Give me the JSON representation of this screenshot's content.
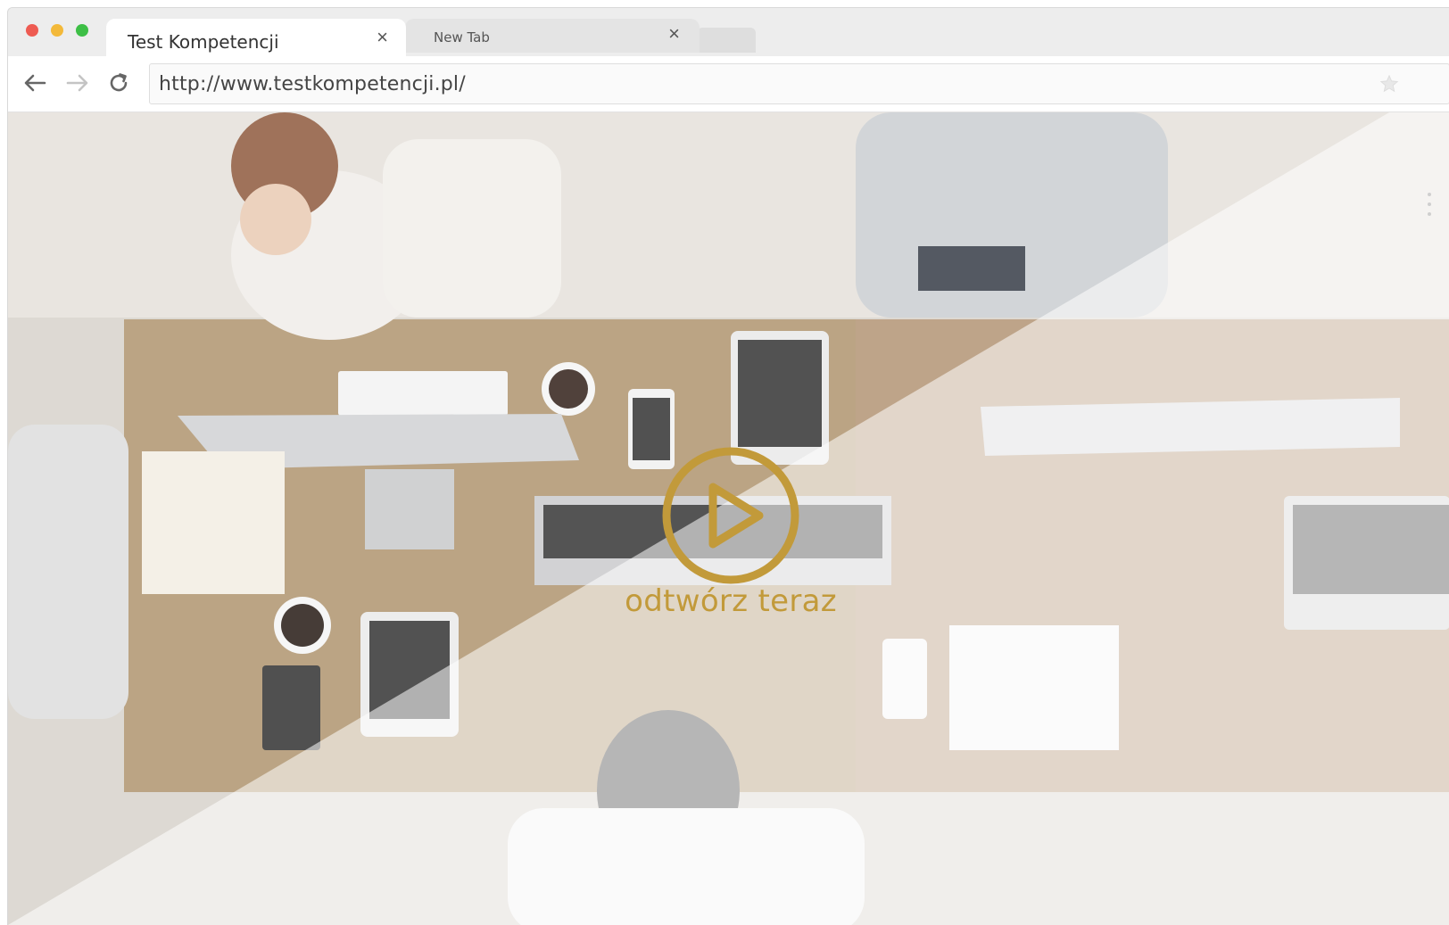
{
  "window": {
    "controls": [
      "close",
      "minimize",
      "maximize"
    ]
  },
  "tabs": [
    {
      "label": "Test Kompetencji",
      "active": true,
      "close": "×"
    },
    {
      "label": "New Tab",
      "active": false,
      "close": "×"
    }
  ],
  "toolbar": {
    "back_icon": "arrow-left-icon",
    "forward_icon": "arrow-right-icon",
    "reload_icon": "reload-icon",
    "url": "http://www.testkompetencji.pl/",
    "bookmark_icon": "star-icon"
  },
  "hero": {
    "play_icon": "play-circle-icon",
    "play_label": "odtwórz teraz",
    "accent_color": "#c29a3a"
  }
}
